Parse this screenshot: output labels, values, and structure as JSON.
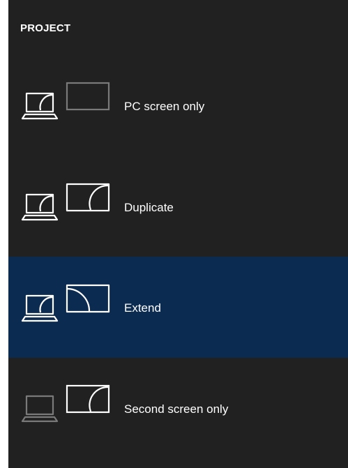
{
  "panel": {
    "title": "PROJECT"
  },
  "options": [
    {
      "label": "PC screen only",
      "icon": "pc-screen-only-icon",
      "selected": false
    },
    {
      "label": "Duplicate",
      "icon": "duplicate-icon",
      "selected": false
    },
    {
      "label": "Extend",
      "icon": "extend-icon",
      "selected": true
    },
    {
      "label": "Second screen only",
      "icon": "second-screen-only-icon",
      "selected": false
    }
  ],
  "colors": {
    "background": "#212121",
    "selected": "#0c2b51",
    "active_stroke": "#ffffff",
    "inactive_stroke": "#7a7a7a"
  }
}
